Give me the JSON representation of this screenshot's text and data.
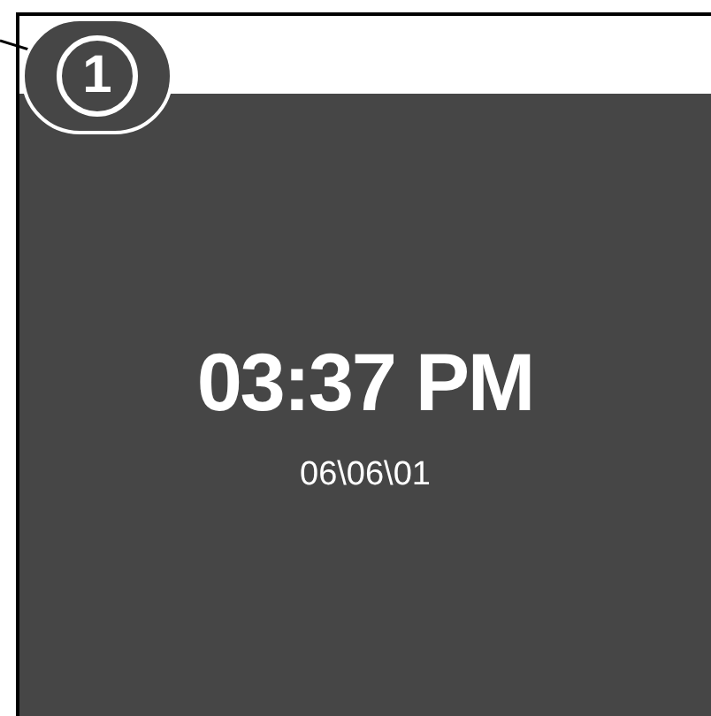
{
  "callout": {
    "number": "1"
  },
  "screen": {
    "time": "03:37 PM",
    "date": "06\\06\\01"
  }
}
